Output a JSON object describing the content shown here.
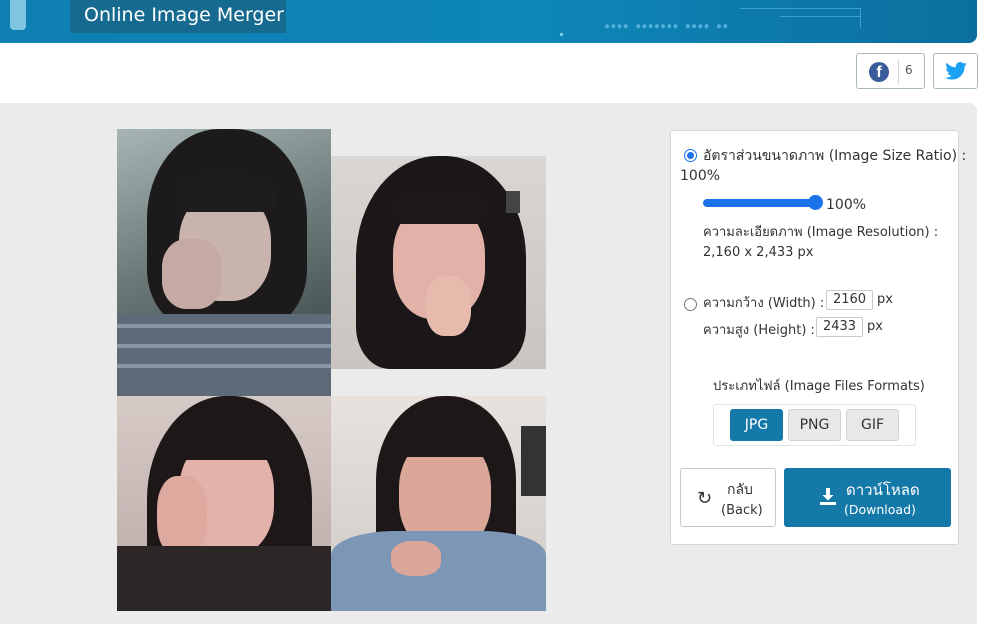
{
  "header": {
    "title": "Online Image Merger"
  },
  "share": {
    "facebook_count": "6"
  },
  "options": {
    "ratio_label": "อัตราส่วนขนาดภาพ (Image Size Ratio) :",
    "ratio_value": "100%",
    "slider_value": "100%",
    "resolution_label": "ความละเอียดภาพ (Image Resolution) :",
    "resolution_value": "2,160 x 2,433 px",
    "width_label": "ความกว้าง (Width) :",
    "width_value": "2160",
    "height_label": "ความสูง (Height) :",
    "height_value": "2433",
    "unit": "px",
    "formats_label": "ประเภทไฟล์ (Image Files Formats)",
    "formats": [
      "JPG",
      "PNG",
      "GIF"
    ],
    "selected_format": "JPG"
  },
  "buttons": {
    "back_label": "กลับ",
    "back_sub": "(Back)",
    "download_label": "ดาวน์โหลด",
    "download_sub": "(Download)"
  },
  "colors": {
    "accent": "#1479a9",
    "slider": "#1a73e8",
    "facebook": "#3b5c9a",
    "twitter": "#1da1f2"
  },
  "icons": [
    "facebook-icon",
    "twitter-icon",
    "refresh-icon",
    "download-icon"
  ]
}
